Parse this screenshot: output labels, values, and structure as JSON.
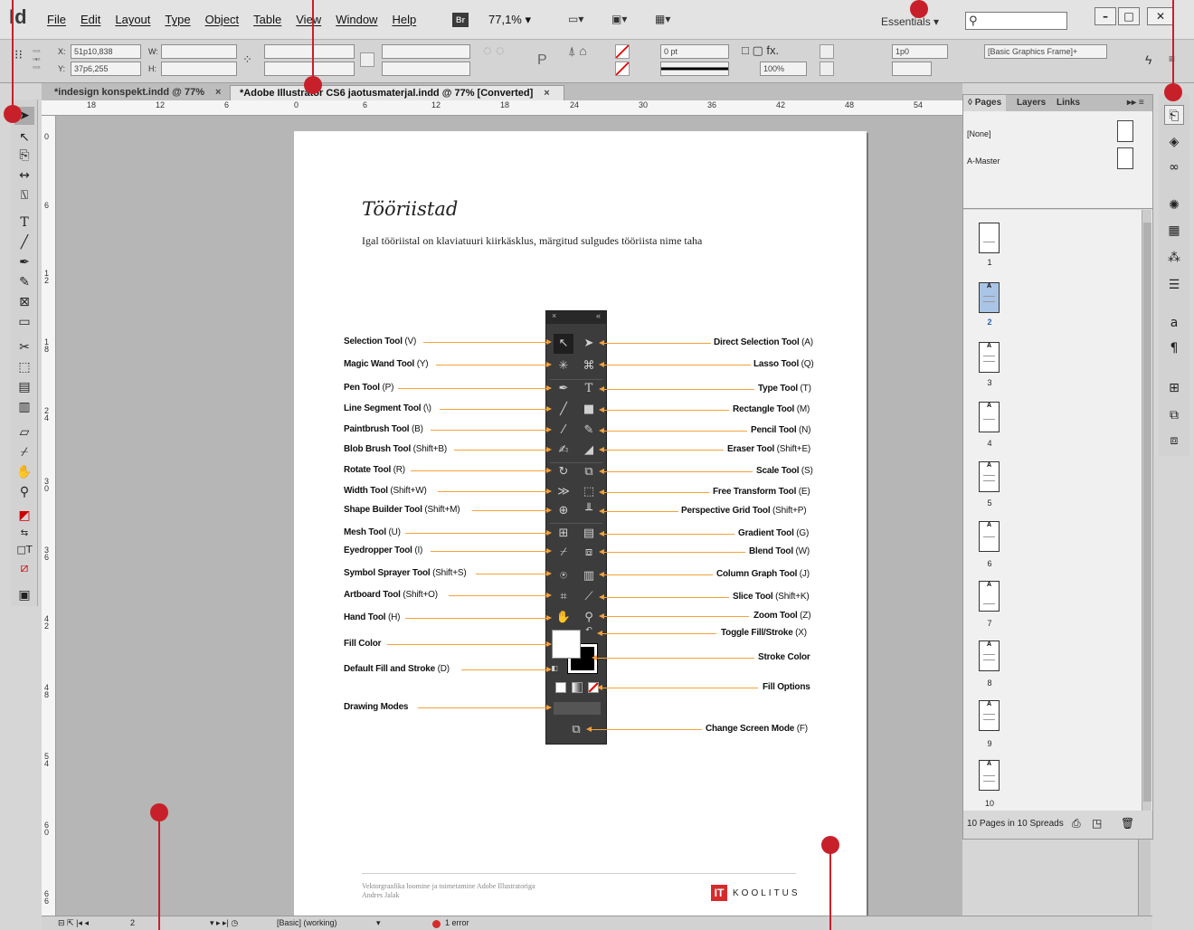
{
  "app": {
    "logo": "Id"
  },
  "menu": [
    "File",
    "Edit",
    "Layout",
    "Type",
    "Object",
    "Table",
    "View",
    "Window",
    "Help"
  ],
  "menubar": {
    "bridge": "Br",
    "zoom": "77,1% ▾",
    "workspace": "Essentials ▾",
    "search_placeholder": "",
    "win_min": "–",
    "win_max": "□",
    "win_close": "✕"
  },
  "control": {
    "x_label": "X:",
    "x_value": "51p10,838",
    "y_label": "Y:",
    "y_value": "37p6,255",
    "w_label": "W:",
    "h_label": "H:",
    "stroke_weight": "0 pt",
    "opacity": "100%",
    "gutter": "1p0",
    "frame_style": "[Basic Graphics Frame]+"
  },
  "tabs": [
    {
      "label": "*indesign konspekt.indd @ 77%",
      "close": "×"
    },
    {
      "label": "*Adobe Illustrator CS6 jaotusmaterjal.indd @ 77% [Converted]",
      "close": "×"
    }
  ],
  "ruler": {
    "h": [
      "18",
      "12",
      "6",
      "0",
      "6",
      "12",
      "18",
      "24",
      "30",
      "36",
      "42",
      "48",
      "54"
    ],
    "v": [
      "0",
      "6",
      "1 2",
      "1 8",
      "2 4",
      "3 0",
      "3 6",
      "4 2",
      "4 8",
      "5 4",
      "6 0",
      "6 6"
    ]
  },
  "document": {
    "title": "Tööriistad",
    "subtitle": "Igal tööriistal on klaviatuuri kiirkäsklus, märgitud sulgudes tööriista nime taha",
    "footer_line1": "Vektorgraafika loomine ja toimetamine Adobe Illustratoriga",
    "footer_line2": "Andres Jalak",
    "brand_icon": "IT",
    "brand_text": "KOOLITUS"
  },
  "left_labels": [
    {
      "name": "Selection Tool",
      "key": "(V)"
    },
    {
      "name": "Magic Wand Tool",
      "key": "(Y)"
    },
    {
      "name": "Pen Tool",
      "key": "(P)"
    },
    {
      "name": "Line Segment Tool",
      "key": "(\\)"
    },
    {
      "name": "Paintbrush Tool",
      "key": "(B)"
    },
    {
      "name": "Blob Brush Tool",
      "key": "(Shift+B)"
    },
    {
      "name": "Rotate Tool",
      "key": "(R)"
    },
    {
      "name": "Width Tool",
      "key": "(Shift+W)"
    },
    {
      "name": "Shape Builder Tool",
      "key": "(Shift+M)"
    },
    {
      "name": "Mesh Tool",
      "key": "(U)"
    },
    {
      "name": "Eyedropper Tool",
      "key": "(I)"
    },
    {
      "name": "Symbol Sprayer Tool",
      "key": "(Shift+S)"
    },
    {
      "name": "Artboard Tool",
      "key": "(Shift+O)"
    },
    {
      "name": "Hand Tool",
      "key": "(H)"
    },
    {
      "name": "Fill Color",
      "key": ""
    },
    {
      "name": "Default Fill and Stroke",
      "key": "(D)"
    },
    {
      "name": "Drawing Modes",
      "key": ""
    }
  ],
  "right_labels": [
    {
      "name": "Direct Selection Tool",
      "key": "(A)"
    },
    {
      "name": "Lasso Tool",
      "key": "(Q)"
    },
    {
      "name": "Type Tool",
      "key": "(T)"
    },
    {
      "name": "Rectangle Tool",
      "key": "(M)"
    },
    {
      "name": "Pencil Tool",
      "key": "(N)"
    },
    {
      "name": "Eraser Tool",
      "key": "(Shift+E)"
    },
    {
      "name": "Scale Tool",
      "key": "(S)"
    },
    {
      "name": "Free Transform Tool",
      "key": "(E)"
    },
    {
      "name": "Perspective Grid Tool",
      "key": "(Shift+P)"
    },
    {
      "name": "Gradient Tool",
      "key": "(G)"
    },
    {
      "name": "Blend Tool",
      "key": "(W)"
    },
    {
      "name": "Column Graph Tool",
      "key": "(J)"
    },
    {
      "name": "Slice Tool",
      "key": "(Shift+K)"
    },
    {
      "name": "Zoom Tool",
      "key": "(Z)"
    },
    {
      "name": "Toggle Fill/Stroke",
      "key": "(X)"
    },
    {
      "name": "Stroke Color",
      "key": ""
    },
    {
      "name": "Fill Options",
      "key": ""
    },
    {
      "name": "Change Screen Mode",
      "key": "(F)"
    }
  ],
  "pages_panel": {
    "tabs": [
      "◊ Pages",
      "Layers",
      "Links"
    ],
    "masters": [
      "[None]",
      "A-Master"
    ],
    "pages": [
      "1",
      "2",
      "3",
      "4",
      "5",
      "6",
      "7",
      "8",
      "9",
      "10"
    ],
    "selected_page": "2",
    "master_letter": "A",
    "count": "10 Pages in 10 Spreads"
  },
  "status": {
    "page": "2",
    "style": "[Basic] (working)",
    "errors": "1 error"
  },
  "colors": {
    "accent_arrow": "#f5a13a",
    "marker": "#c8202a",
    "brand": "#d72b2b"
  }
}
